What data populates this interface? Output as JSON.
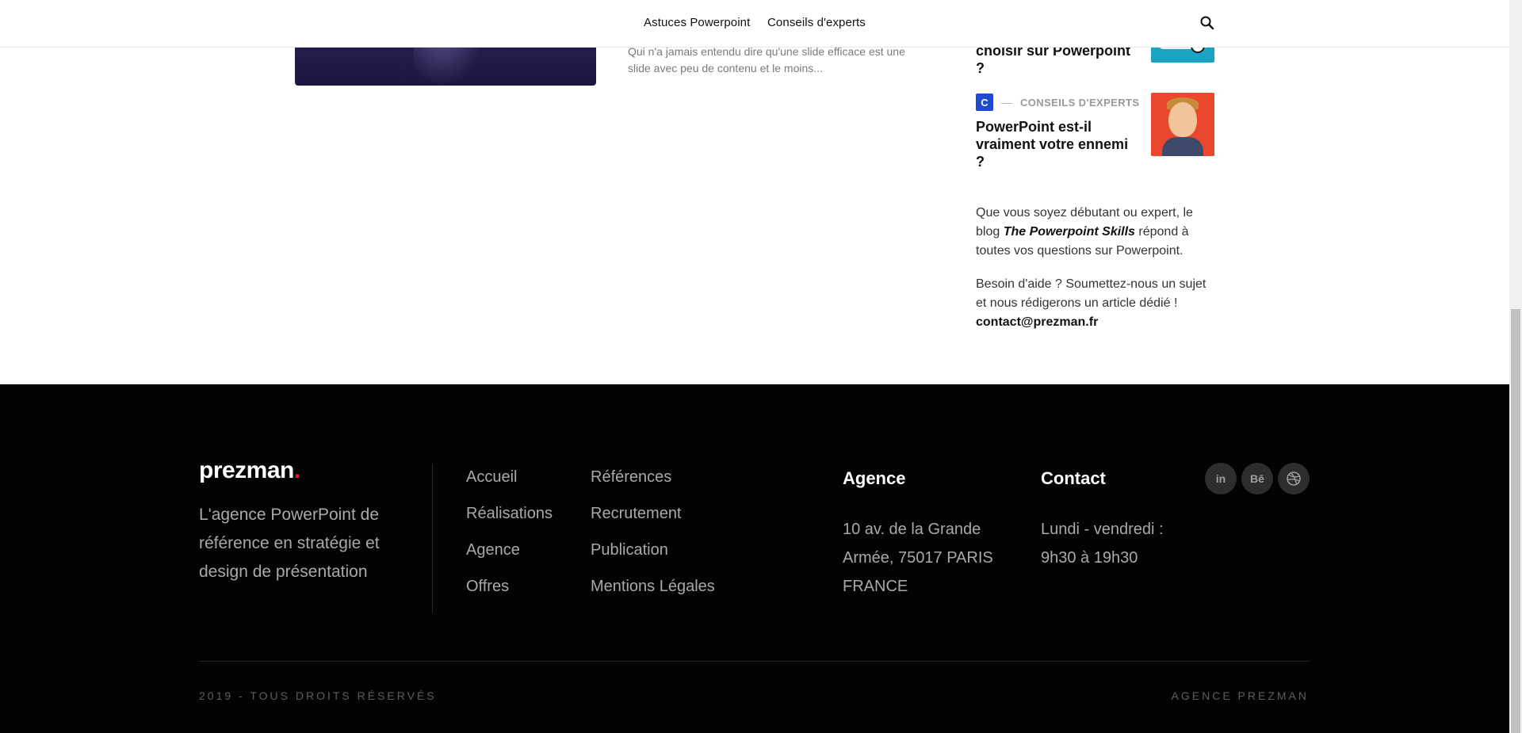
{
  "nav": {
    "items": [
      {
        "label": "Astuces Powerpoint"
      },
      {
        "label": "Conseils d'experts"
      }
    ],
    "search_icon": "search-icon"
  },
  "article": {
    "excerpt": "Qui n'a jamais entendu dire qu'une slide efficace est une slide avec peu de contenu et le moins..."
  },
  "sidebar": {
    "posts": [
      {
        "title": "choisir sur Powerpoint ?"
      },
      {
        "category_badge": "C",
        "category": "CONSEILS D'EXPERTS",
        "title": "PowerPoint est-il vraiment votre ennemi ?"
      }
    ],
    "about": {
      "p1_a": "Que vous soyez débutant ou expert, le blog ",
      "p1_em": "The Powerpoint Skills",
      "p1_b": " répond à toutes vos questions sur Powerpoint.",
      "p2_a": "Besoin d'aide ? Soumettez-nous un sujet et nous rédigerons un article dédié ! ",
      "p2_email": "contact@prezman.fr"
    }
  },
  "footer": {
    "logo": "prezman",
    "logo_dot": ".",
    "tagline": "L'agence PowerPoint de référence en stratégie et design de présentation",
    "links_col1": [
      "Accueil",
      "Réalisations",
      "Agence",
      "Offres"
    ],
    "links_col2": [
      "Références",
      "Recrutement",
      "Publication",
      "Mentions Légales"
    ],
    "agence": {
      "heading": "Agence",
      "line1": "10 av. de la Grande",
      "line2": "Armée, 75017 PARIS",
      "line3": "FRANCE"
    },
    "contact": {
      "heading": "Contact",
      "line1": "Lundi - vendredi :",
      "line2": "9h30 à 19h30"
    },
    "social": [
      {
        "icon": "linkedin-icon",
        "label": "in"
      },
      {
        "icon": "behance-icon",
        "label": "Bē"
      },
      {
        "icon": "dribbble-icon",
        "label": ""
      }
    ],
    "copyright": "2019 - TOUS DROITS RÉSERVÉS",
    "agency_name": "AGENCE PREZMAN"
  },
  "colors": {
    "accent_dot": "#e4163a",
    "category_badge": "#1e4bd0",
    "footer_bg": "#030303"
  }
}
